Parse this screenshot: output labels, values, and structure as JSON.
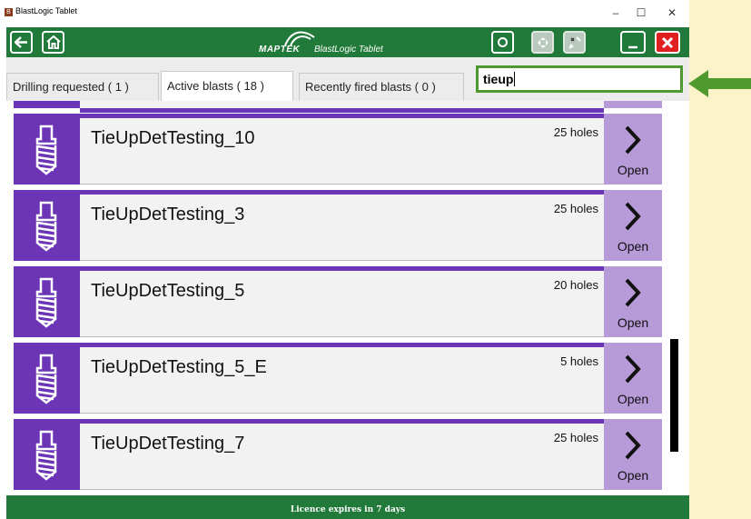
{
  "window": {
    "title": "BlastLogic Tablet"
  },
  "toolbar": {
    "brand": "MAPTEK",
    "product": "BlastLogic Tablet",
    "icons": [
      "back-arrow-icon",
      "home-icon",
      "refresh-icon",
      "sync-icon",
      "disconnect-icon",
      "minimize-icon",
      "close-icon"
    ]
  },
  "tabs": [
    {
      "label": "Drilling requested ( 1 )"
    },
    {
      "label": "Active blasts ( 18 )"
    },
    {
      "label": "Recently fired blasts ( 0 )"
    }
  ],
  "search": {
    "value": "tieup"
  },
  "blasts": [
    {
      "name": "TieUpDetTesting_10",
      "holes": "25 holes",
      "action": "Open"
    },
    {
      "name": "TieUpDetTesting_3",
      "holes": "25 holes",
      "action": "Open"
    },
    {
      "name": "TieUpDetTesting_5",
      "holes": "20 holes",
      "action": "Open"
    },
    {
      "name": "TieUpDetTesting_5_E",
      "holes": "5 holes",
      "action": "Open"
    },
    {
      "name": "TieUpDetTesting_7",
      "holes": "25 holes",
      "action": "Open"
    }
  ],
  "footer": {
    "licence": "Licence expires in 7 days"
  },
  "colors": {
    "toolbar": "#217a3a",
    "blast_accent": "#6b35b5",
    "open_button": "#b79ad8",
    "highlight": "#4e9a2f",
    "close": "#e02020"
  }
}
